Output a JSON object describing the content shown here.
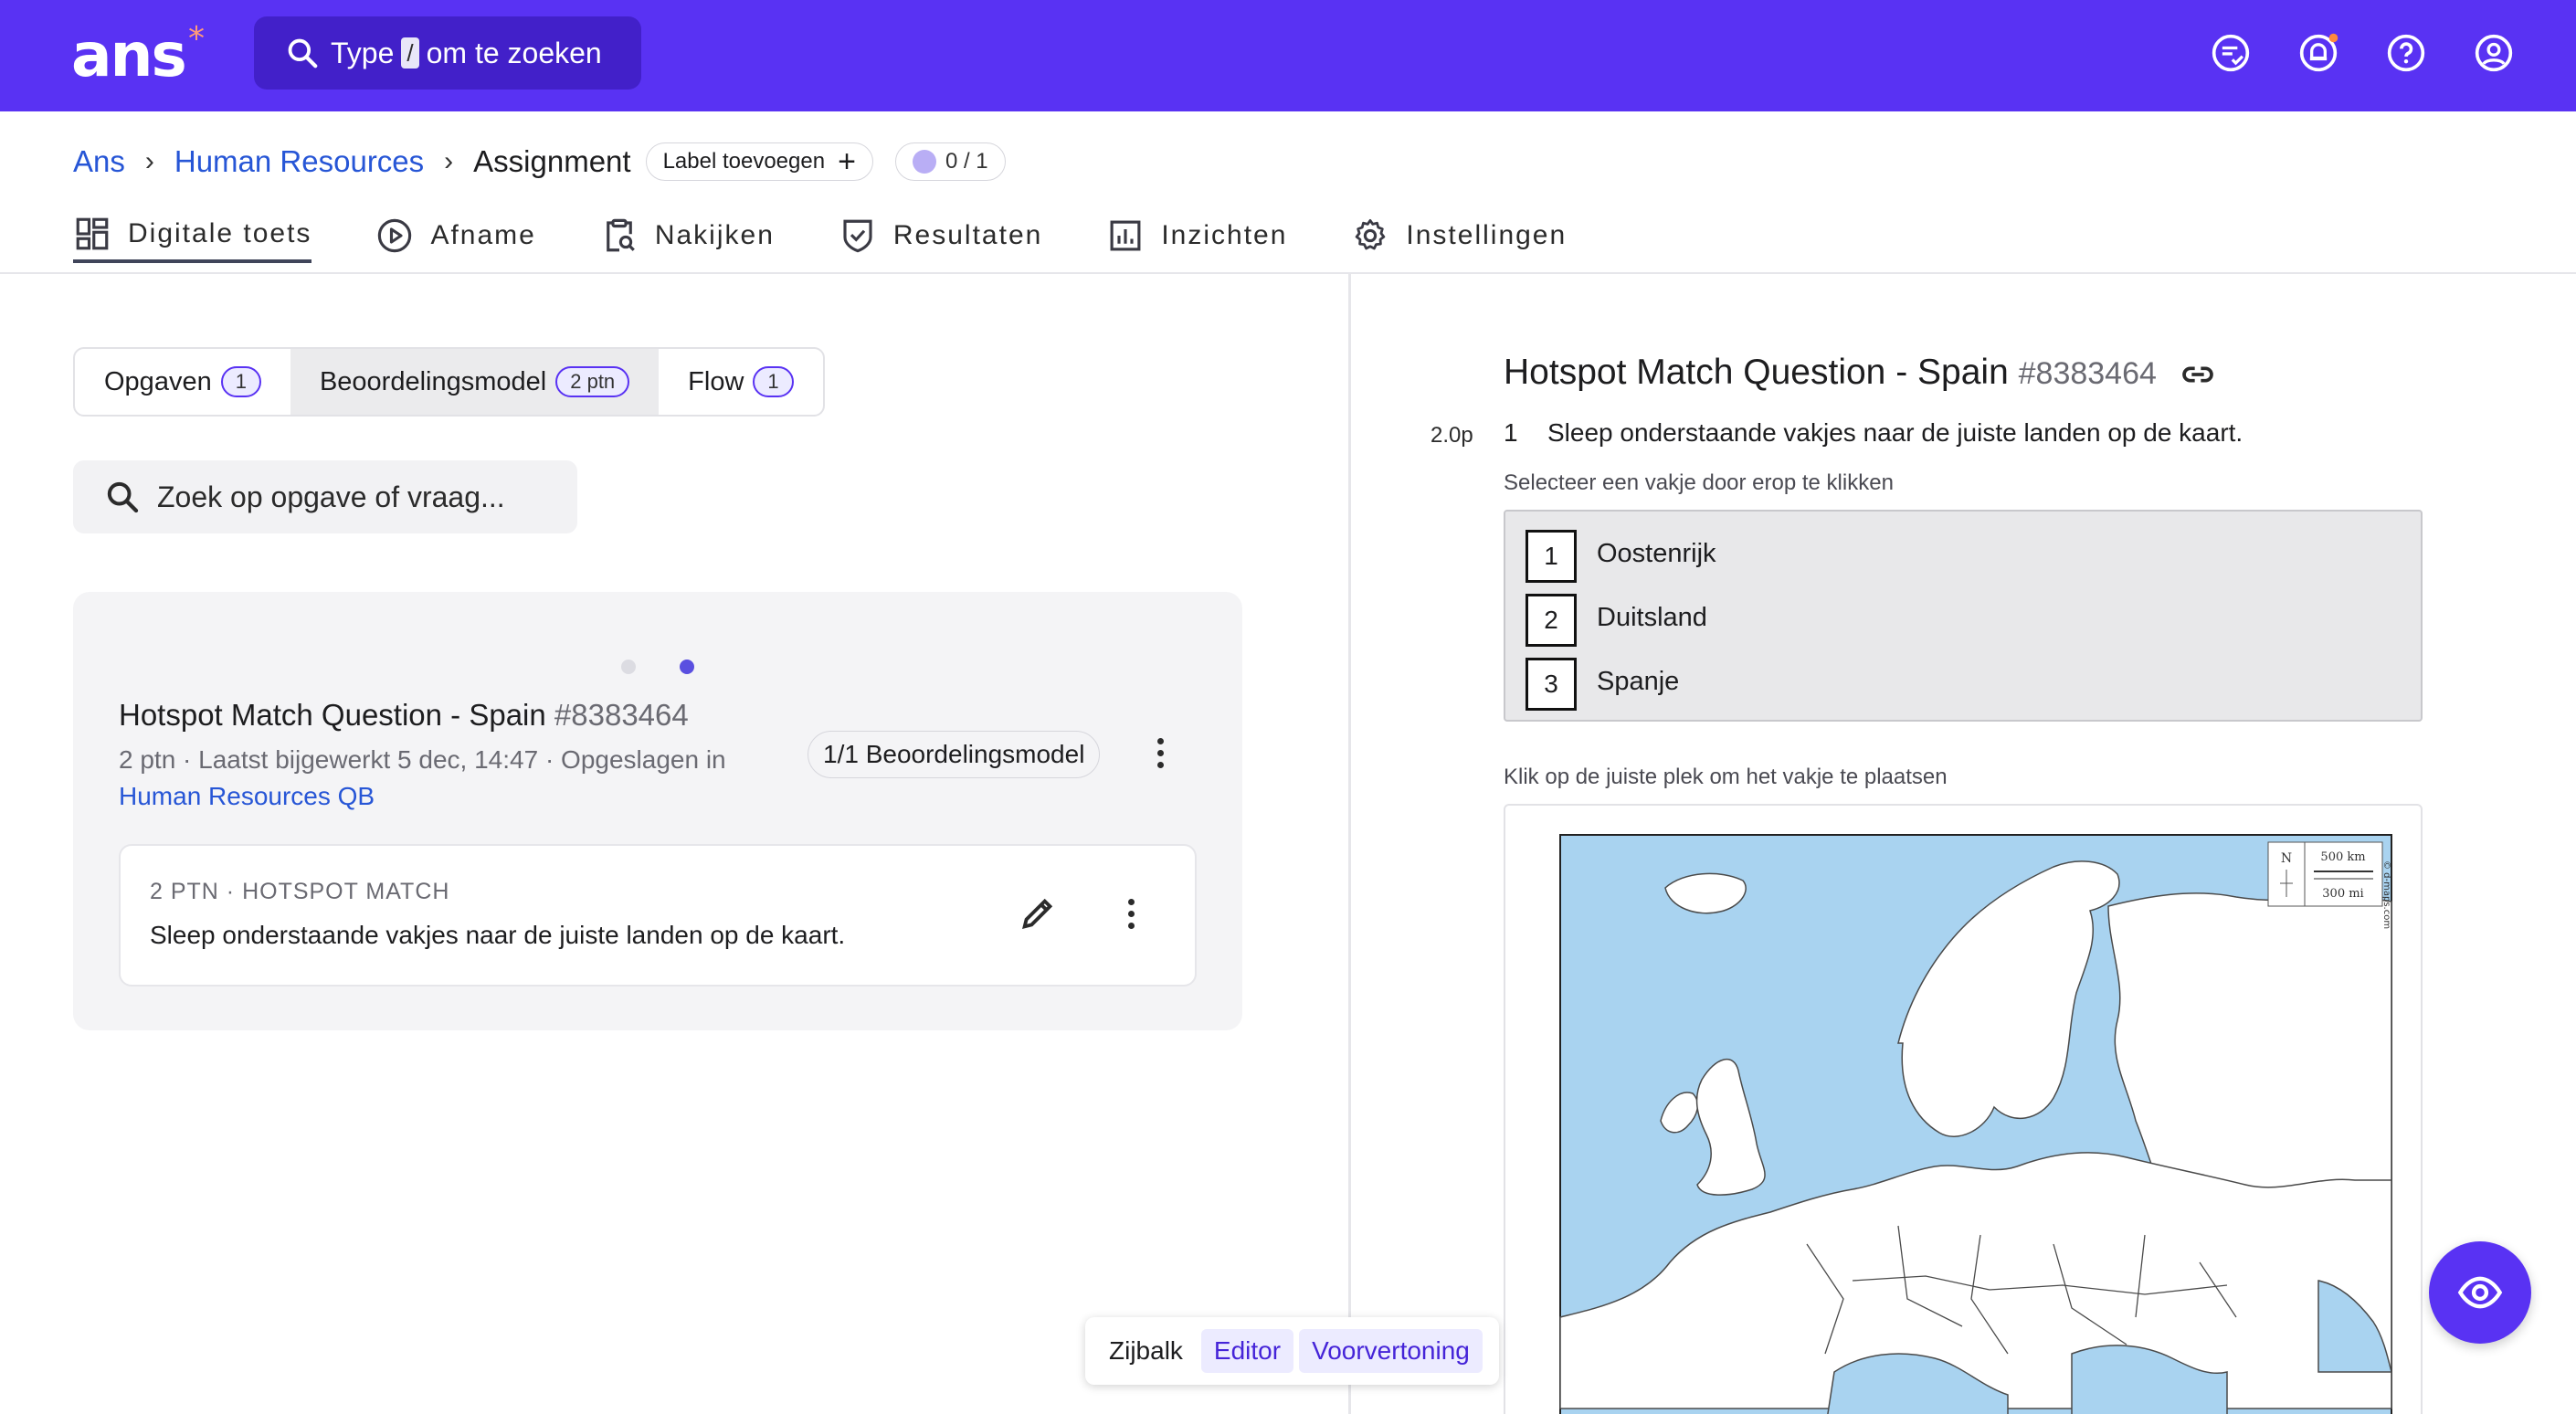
{
  "app": {
    "logo_text": "ans",
    "logo_star": "*",
    "search": {
      "prefix": "Type",
      "key": "/",
      "suffix": "om te zoeken"
    },
    "top_icons": [
      "feedback-icon",
      "bell-icon",
      "help-icon",
      "account-icon"
    ],
    "colors": {
      "brand": "#5932f3",
      "link": "#2756d6",
      "notification": "#ff8a3d"
    }
  },
  "breadcrumb": {
    "items": [
      "Ans",
      "Human Resources"
    ],
    "current": "Assignment",
    "label_button": "Label toevoegen",
    "label_plus": "+",
    "progress": "0 / 1"
  },
  "nav": {
    "tabs": [
      {
        "label": "Digitale toets",
        "icon": "dashboard-icon",
        "active": true
      },
      {
        "label": "Afname",
        "icon": "play-icon"
      },
      {
        "label": "Nakijken",
        "icon": "clipboard-search-icon"
      },
      {
        "label": "Resultaten",
        "icon": "shield-check-icon"
      },
      {
        "label": "Inzichten",
        "icon": "chart-icon"
      },
      {
        "label": "Instellingen",
        "icon": "gear-icon"
      }
    ]
  },
  "left": {
    "tabs": [
      {
        "label": "Opgaven",
        "badge": "1"
      },
      {
        "label": "Beoordelingsmodel",
        "badge": "2 ptn",
        "active": true
      },
      {
        "label": "Flow",
        "badge": "1"
      }
    ],
    "search_placeholder": "Zoek op opgave of vraag...",
    "card": {
      "title": "Hotspot Match Question - Spain",
      "id": "#8383464",
      "meta": "2 ptn · Laatst bijgewerkt 5 dec, 14:47 · Opgeslagen in",
      "qb_link": "Human Resources QB",
      "model_pill": "1/1 Beoordelingsmodel",
      "question": {
        "type": "2 PTN · HOTSPOT MATCH",
        "text": "Sleep onderstaande vakjes naar de juiste landen op de kaart."
      }
    }
  },
  "right": {
    "title": "Hotspot Match Question - Spain",
    "id": "#8383464",
    "points": "2.0p",
    "question_number": "1",
    "question_text": "Sleep onderstaande vakjes naar de juiste landen op de kaart.",
    "instruction_select": "Selecteer een vakje door erop te klikken",
    "tiles": [
      {
        "number": "1",
        "label": "Oostenrijk"
      },
      {
        "number": "2",
        "label": "Duitsland"
      },
      {
        "number": "3",
        "label": "Spanje"
      }
    ],
    "instruction_place": "Klik op de juiste plek om het vakje te plaatsen",
    "map": {
      "scale_km": "500 km",
      "scale_mi": "300 mi",
      "north": "N",
      "credit": "© d-maps.com",
      "colors": {
        "sea": "#a9d3f0",
        "land": "#ffffff",
        "border": "#4a4a4a"
      }
    }
  },
  "bottombar": {
    "items": [
      {
        "label": "Zijbalk"
      },
      {
        "label": "Editor",
        "selected": true
      },
      {
        "label": "Voorvertoning",
        "selected": true
      }
    ]
  },
  "fab": {
    "icon": "eye-icon"
  }
}
